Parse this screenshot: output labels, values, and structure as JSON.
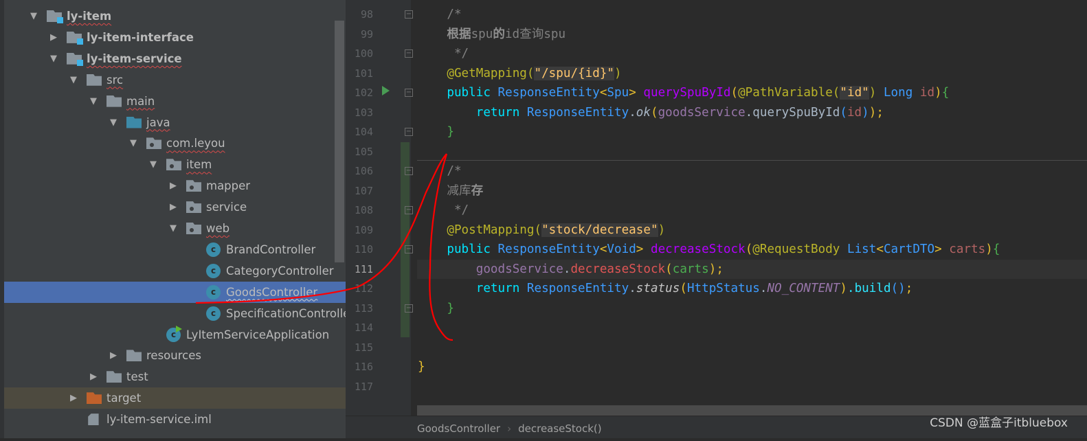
{
  "project_tree": {
    "items": [
      {
        "label": "ly-item",
        "level": 0,
        "arrow": "open",
        "icon": "module-folder",
        "bold": true,
        "squiggle": true
      },
      {
        "label": "ly-item-interface",
        "level": 1,
        "arrow": "closed",
        "icon": "module-folder",
        "bold": true
      },
      {
        "label": "ly-item-service",
        "level": 1,
        "arrow": "open",
        "icon": "module-folder",
        "bold": true,
        "squiggle": true
      },
      {
        "label": "src",
        "level": 2,
        "arrow": "open",
        "icon": "folder",
        "squiggle": true
      },
      {
        "label": "main",
        "level": 3,
        "arrow": "open",
        "icon": "folder",
        "squiggle": true
      },
      {
        "label": "java",
        "level": 4,
        "arrow": "open",
        "icon": "source-folder",
        "squiggle": true
      },
      {
        "label": "com.leyou",
        "level": 5,
        "arrow": "open",
        "icon": "package",
        "squiggle": true
      },
      {
        "label": "item",
        "level": 6,
        "arrow": "open",
        "icon": "package",
        "squiggle": true
      },
      {
        "label": "mapper",
        "level": 7,
        "arrow": "closed",
        "icon": "package"
      },
      {
        "label": "service",
        "level": 7,
        "arrow": "closed",
        "icon": "package"
      },
      {
        "label": "web",
        "level": 7,
        "arrow": "open",
        "icon": "package",
        "squiggle": true
      },
      {
        "label": "BrandController",
        "level": 8,
        "icon": "class"
      },
      {
        "label": "CategoryController",
        "level": 8,
        "icon": "class"
      },
      {
        "label": "GoodsController",
        "level": 8,
        "icon": "class",
        "selected": true
      },
      {
        "label": "SpecificationControlle",
        "level": 8,
        "icon": "class"
      },
      {
        "label": "LyItemServiceApplication",
        "level": 6,
        "icon": "spring-boot-class"
      },
      {
        "label": "resources",
        "level": 4,
        "arrow": "closed",
        "icon": "resources-folder"
      },
      {
        "label": "test",
        "level": 3,
        "arrow": "closed",
        "icon": "folder"
      },
      {
        "label": "target",
        "level": 2,
        "arrow": "closed",
        "icon": "excluded-folder",
        "highlight": true
      },
      {
        "label": "ly-item-service.iml",
        "level": 2,
        "icon": "iml-file"
      }
    ]
  },
  "editor": {
    "current_line": 111,
    "lines": [
      {
        "n": "98",
        "tokens": [
          [
            "    /*",
            "c-cm"
          ]
        ]
      },
      {
        "n": "99",
        "tokens": [
          [
            "    ",
            "c-cm"
          ],
          [
            "根据",
            "c-cmb"
          ],
          [
            "spu",
            "c-cm"
          ],
          [
            "的",
            "c-cmb"
          ],
          [
            "id查询spu",
            "c-cm"
          ]
        ]
      },
      {
        "n": "100",
        "tokens": [
          [
            "     */",
            "c-cm"
          ]
        ]
      },
      {
        "n": "101",
        "tokens": [
          [
            "    @GetMapping(",
            "c-ann"
          ],
          [
            "\"/spu/{id}\"",
            "c-strh"
          ],
          [
            ")",
            "c-ann"
          ]
        ]
      },
      {
        "n": "102",
        "tokens": [
          [
            "    public ",
            "c-kw"
          ],
          [
            "ResponseEntity",
            "c-ty"
          ],
          [
            "<",
            "c-y"
          ],
          [
            "Spu",
            "c-ty"
          ],
          [
            "> ",
            "c-y"
          ],
          [
            "querySpuById",
            "c-fn"
          ],
          [
            "(",
            "c-y"
          ],
          [
            "@PathVariable(",
            "c-ann"
          ],
          [
            "\"id\"",
            "c-strh"
          ],
          [
            ") ",
            "c-ann"
          ],
          [
            "Long ",
            "c-ty"
          ],
          [
            "id",
            "c-par"
          ],
          [
            ")",
            "c-y"
          ],
          [
            "{",
            "c-g"
          ]
        ]
      },
      {
        "n": "103",
        "tokens": [
          [
            "        return ",
            "c-kw"
          ],
          [
            "ResponseEntity",
            "c-ty"
          ],
          [
            ".",
            "c-pl"
          ],
          [
            "ok",
            "c-ok"
          ],
          [
            "(",
            "c-y"
          ],
          [
            "goodsService",
            "c-var"
          ],
          [
            ".querySpuById",
            "c-pl"
          ],
          [
            "(",
            "c-ty"
          ],
          [
            "id",
            "c-par"
          ],
          [
            ")",
            "c-ty"
          ],
          [
            ")",
            "c-y"
          ],
          [
            ";",
            "c-y"
          ]
        ]
      },
      {
        "n": "104",
        "tokens": [
          [
            "    }",
            "c-g"
          ]
        ]
      },
      {
        "n": "105",
        "tokens": []
      },
      {
        "n": "106",
        "tokens": [
          [
            "    /*",
            "c-cm"
          ]
        ]
      },
      {
        "n": "107",
        "tokens": [
          [
            "    减库",
            "c-cm"
          ],
          [
            "存",
            "c-cmb"
          ]
        ]
      },
      {
        "n": "108",
        "tokens": [
          [
            "     */",
            "c-cm"
          ]
        ]
      },
      {
        "n": "109",
        "tokens": [
          [
            "    @PostMapping(",
            "c-ann"
          ],
          [
            "\"stock/decrease\"",
            "c-strh"
          ],
          [
            ")",
            "c-ann"
          ]
        ]
      },
      {
        "n": "110",
        "tokens": [
          [
            "    public ",
            "c-kw"
          ],
          [
            "ResponseEntity",
            "c-ty"
          ],
          [
            "<",
            "c-y"
          ],
          [
            "Void",
            "c-ty"
          ],
          [
            "> ",
            "c-y"
          ],
          [
            "decreaseStock",
            "c-fn"
          ],
          [
            "(",
            "c-y"
          ],
          [
            "@RequestBody ",
            "c-ann"
          ],
          [
            "List",
            "c-ty"
          ],
          [
            "<",
            "c-y"
          ],
          [
            "CartDTO",
            "c-ty"
          ],
          [
            "> ",
            "c-y"
          ],
          [
            "carts",
            "c-par"
          ],
          [
            ")",
            "c-y"
          ],
          [
            "{",
            "c-g"
          ]
        ]
      },
      {
        "n": "111",
        "tokens": [
          [
            "        goodsService",
            "c-var"
          ],
          [
            ".",
            "c-pl"
          ],
          [
            "decreaseStock",
            "c-red"
          ],
          [
            "(",
            "c-y"
          ],
          [
            "carts",
            "c-g"
          ],
          [
            ")",
            "c-y"
          ],
          [
            ";",
            "c-y"
          ]
        ]
      },
      {
        "n": "112",
        "tokens": [
          [
            "        return ",
            "c-kw"
          ],
          [
            "ResponseEntity",
            "c-ty"
          ],
          [
            ".",
            "c-pl"
          ],
          [
            "status",
            "c-it"
          ],
          [
            "(",
            "c-y"
          ],
          [
            "HttpStatus",
            "c-ty"
          ],
          [
            ".",
            "c-pl"
          ],
          [
            "NO_CONTENT",
            "c-itv"
          ],
          [
            ")",
            "c-y"
          ],
          [
            ".build",
            "c-bi"
          ],
          [
            "()",
            "c-ty"
          ],
          [
            ";",
            "c-y"
          ]
        ]
      },
      {
        "n": "113",
        "tokens": [
          [
            "    }",
            "c-g"
          ]
        ]
      },
      {
        "n": "114",
        "tokens": []
      },
      {
        "n": "115",
        "tokens": []
      },
      {
        "n": "116",
        "tokens": [
          [
            "}",
            "c-y"
          ]
        ]
      },
      {
        "n": "117",
        "tokens": []
      }
    ],
    "fold_lines": [
      "98",
      "100",
      "102",
      "104",
      "106",
      "108",
      "110",
      "113"
    ],
    "run_line": "102"
  },
  "breadcrumb": {
    "items": [
      "GoodsController",
      "decreaseStock()"
    ]
  },
  "watermark": "CSDN @蓝盒子itbluebox",
  "annotation_color": "#ff0000"
}
